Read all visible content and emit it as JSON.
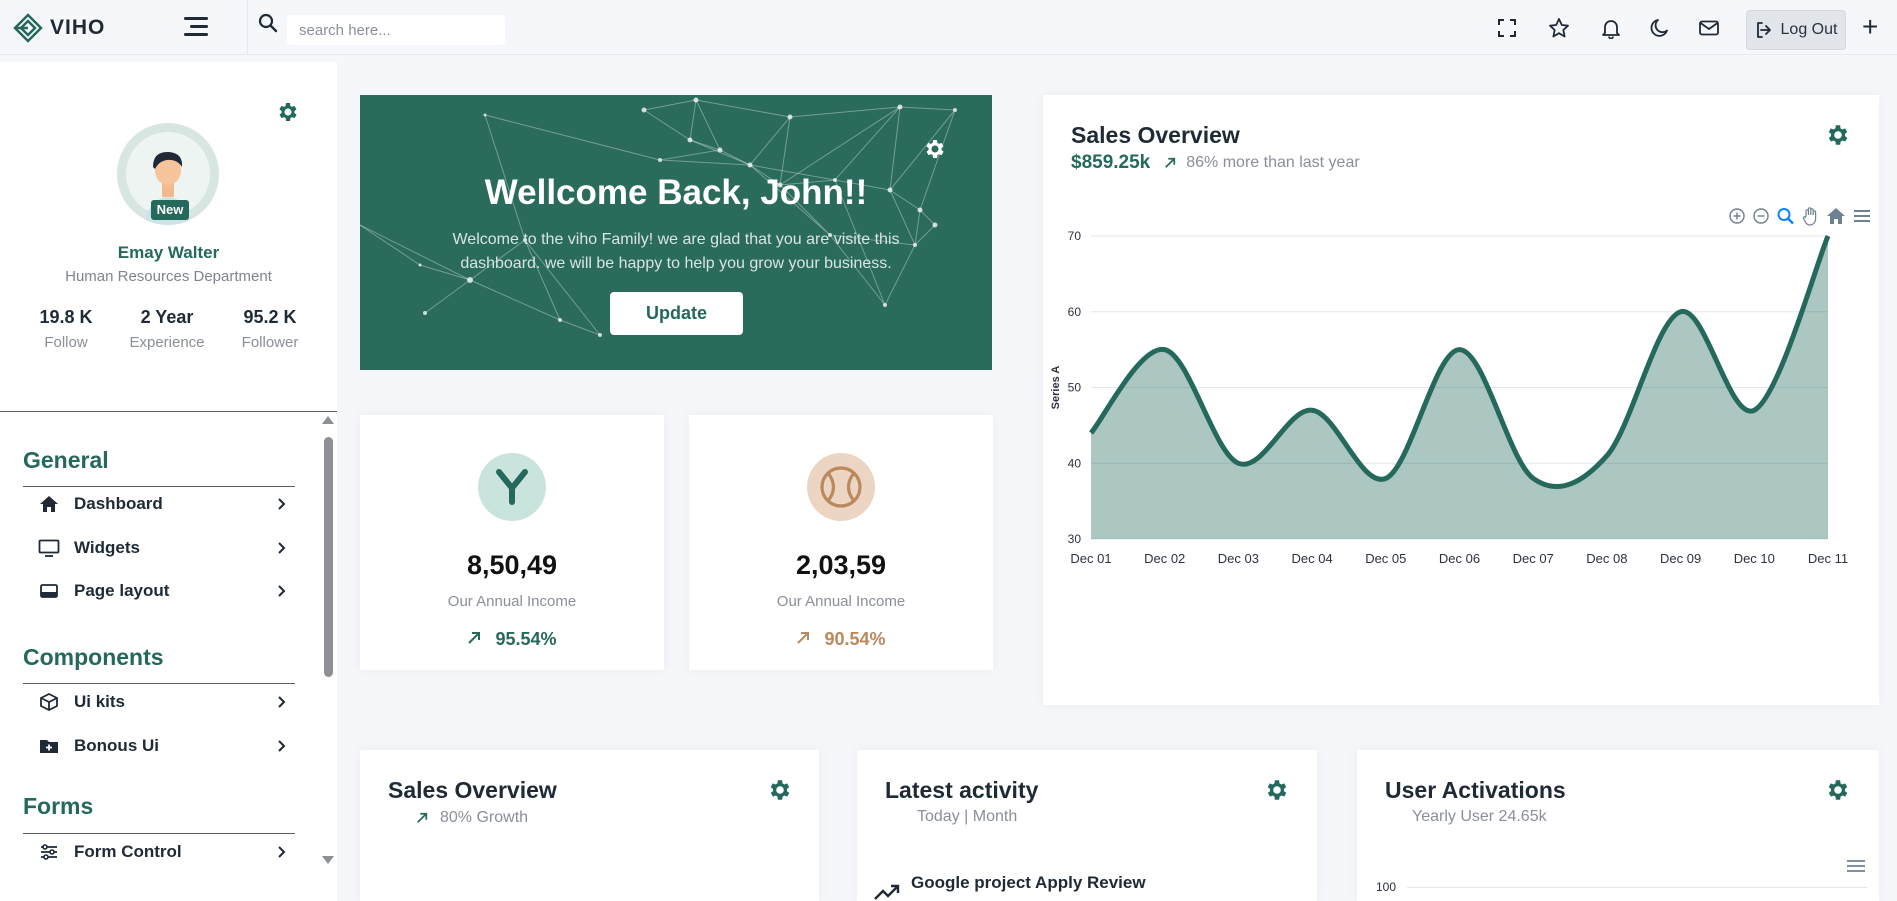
{
  "app": {
    "name": "VIHO"
  },
  "search": {
    "placeholder": "search here..."
  },
  "header": {
    "logout_label": "Log Out"
  },
  "profile": {
    "badge": "New",
    "name": "Emay Walter",
    "department": "Human Resources Department",
    "stats": [
      {
        "value": "19.8 K",
        "label": "Follow"
      },
      {
        "value": "2 Year",
        "label": "Experience"
      },
      {
        "value": "95.2 K",
        "label": "Follower"
      }
    ]
  },
  "nav": {
    "general": "General",
    "components": "Components",
    "forms": "Forms",
    "items": [
      {
        "label": "Dashboard",
        "icon": "home-icon"
      },
      {
        "label": "Widgets",
        "icon": "monitor-icon"
      },
      {
        "label": "Page layout",
        "icon": "layout-icon"
      },
      {
        "label": "Ui kits",
        "icon": "box-icon"
      },
      {
        "label": "Bonous Ui",
        "icon": "folder-plus-icon"
      },
      {
        "label": "Form Control",
        "icon": "sliders-icon"
      }
    ]
  },
  "welcome": {
    "title": "Wellcome Back, John!!",
    "text": "Welcome to the viho Family! we are glad that you are visite this dashboard. we will be happy to help you grow your business.",
    "button": "Update"
  },
  "income_cards": [
    {
      "value": "8,50,49",
      "label": "Our Annual Income",
      "percent": "95.54%",
      "color": "#24695c",
      "bg": "#c9e4dd",
      "icon": "yen-icon"
    },
    {
      "value": "2,03,59",
      "label": "Our Annual Income",
      "percent": "90.54%",
      "color": "#ba895d",
      "bg": "#ecd5c2",
      "icon": "tennis-ball-icon"
    }
  ],
  "sales_overview": {
    "title": "Sales Overview",
    "amount": "$859.25k",
    "subtitle": "86% more than last year"
  },
  "chart_data": {
    "type": "area",
    "x": [
      "Dec 01",
      "Dec 02",
      "Dec 03",
      "Dec 04",
      "Dec 05",
      "Dec 06",
      "Dec 07",
      "Dec 08",
      "Dec 09",
      "Dec 10",
      "Dec 11"
    ],
    "series": [
      {
        "name": "Series A",
        "values": [
          44,
          55,
          40,
          47,
          38,
          55,
          38,
          41,
          60,
          47,
          70
        ]
      }
    ],
    "ylabel": "Series A",
    "ylim": [
      30,
      70
    ],
    "yticks": [
      30,
      40,
      50,
      60,
      70
    ],
    "grid": true,
    "color": "#24695c"
  },
  "bottom_cards": [
    {
      "title": "Sales Overview",
      "subtitle": "80% Growth"
    },
    {
      "title": "Latest activity",
      "subtitle": "Today | Month",
      "activity": "Google project Apply Review"
    },
    {
      "title": "User Activations",
      "subtitle": "Yearly User 24.65k",
      "axis_top": "100"
    }
  ]
}
